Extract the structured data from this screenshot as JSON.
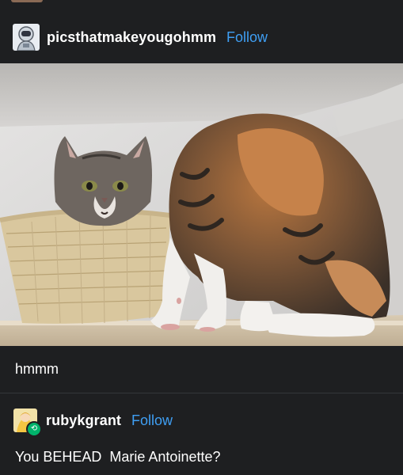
{
  "post": {
    "author": "picsthatmakeyougohmm",
    "follow_label": "Follow",
    "image_alt_icon": "photo-of-two-cats-icon",
    "caption": "hmmm"
  },
  "reblog": {
    "author": "rubykgrant",
    "follow_label": "Follow",
    "badge_icon": "reblog-icon",
    "text": "You BEHEAD  Marie Antoinette?"
  },
  "colors": {
    "background": "#1e1f21",
    "follow": "#3f9ff4",
    "reblog_badge": "#00b36b",
    "text": "#ffffff"
  }
}
